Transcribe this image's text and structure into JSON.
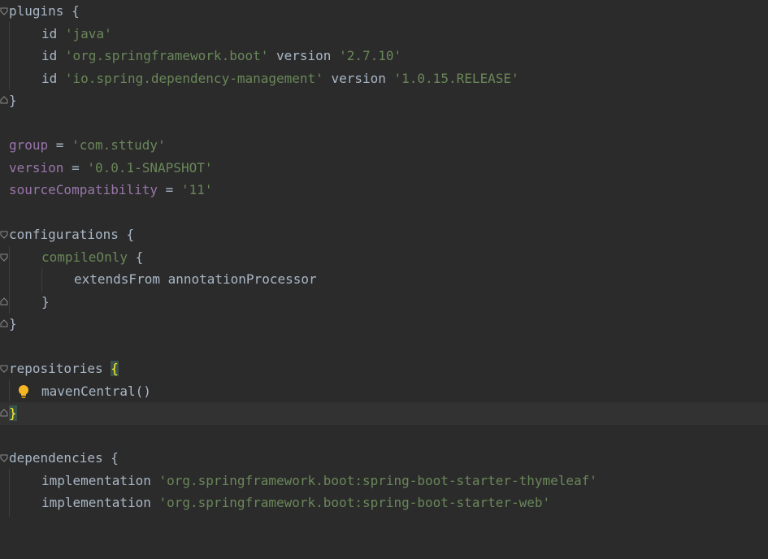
{
  "editor": {
    "language": "groovy",
    "colors": {
      "background": "#2b2b2b",
      "default_text": "#a9b7c6",
      "string": "#6a8759",
      "property": "#9876aa",
      "brace_highlight": "#ffef28"
    },
    "lines": {
      "l1": {
        "kw": "plugins",
        "brace": " {"
      },
      "l2": {
        "kw": "id",
        "str": "'java'"
      },
      "l3": {
        "kw": "id",
        "str": "'org.springframework.boot'",
        "kw2": "version",
        "str2": "'2.7.10'"
      },
      "l4": {
        "kw": "id",
        "str": "'io.spring.dependency-management'",
        "kw2": "version",
        "str2": "'1.0.15.RELEASE'"
      },
      "l5": {
        "brace": "}"
      },
      "l7": {
        "prop": "group",
        "op": " = ",
        "str": "'com.sttudy'"
      },
      "l8": {
        "prop": "version",
        "op": " = ",
        "str": "'0.0.1-SNAPSHOT'"
      },
      "l9": {
        "prop": "sourceCompatibility",
        "op": " = ",
        "str": "'11'"
      },
      "l11": {
        "kw": "configurations",
        "brace": " {"
      },
      "l12": {
        "kw": "compileOnly",
        "brace": " {"
      },
      "l13": {
        "kw": "extendsFrom annotationProcessor"
      },
      "l14": {
        "brace": "}"
      },
      "l15": {
        "brace": "}"
      },
      "l17": {
        "kw": "repositories ",
        "brace": "{"
      },
      "l18": {
        "kw": "mavenCentral()"
      },
      "l19": {
        "brace": "}"
      },
      "l21": {
        "kw": "dependencies",
        "brace": " {"
      },
      "l22": {
        "kw": "implementation",
        "str": "'org.springframework.boot:spring-boot-starter-thymeleaf'"
      },
      "l23": {
        "kw": "implementation",
        "str": "'org.springframework.boot:spring-boot-starter-web'"
      }
    },
    "icons": {
      "fold": "fold-marker-icon",
      "bulb": "lightbulb-icon"
    }
  }
}
